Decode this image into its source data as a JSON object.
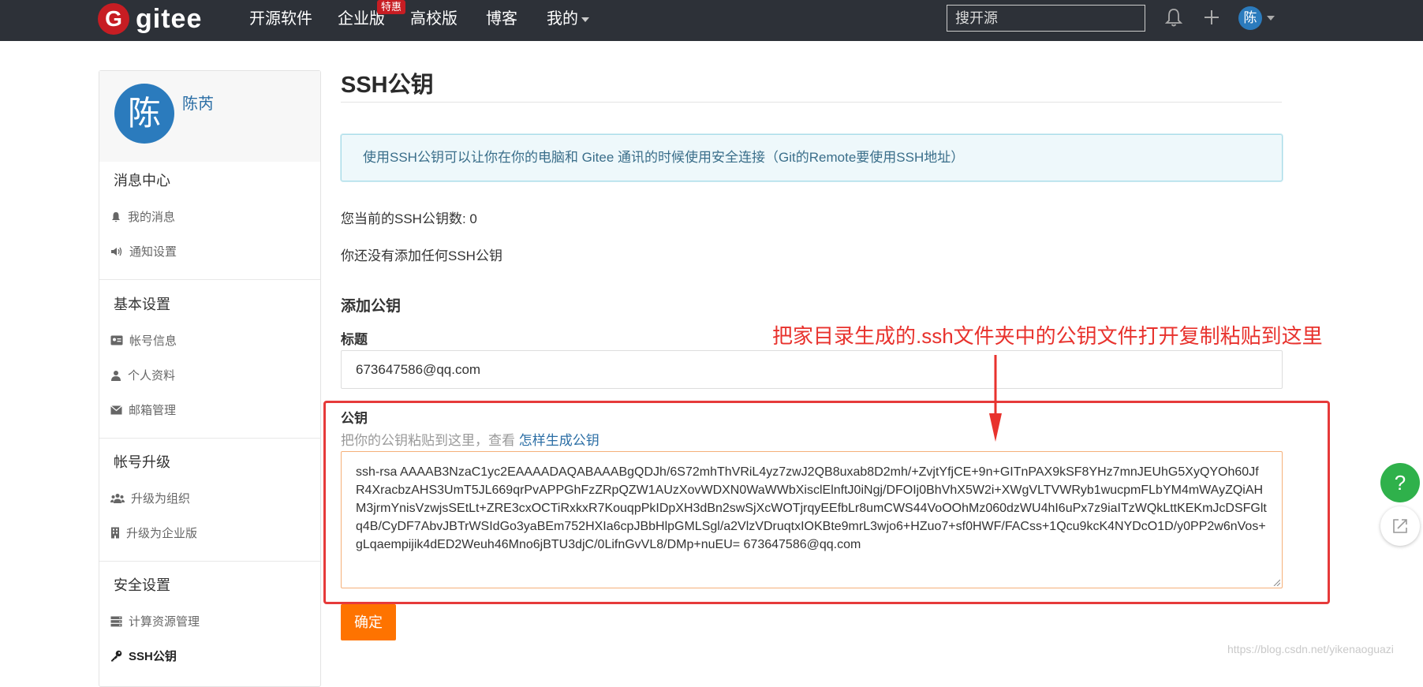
{
  "navbar": {
    "logo_letter": "G",
    "logo_text": "gitee",
    "items": [
      {
        "label": "开源软件"
      },
      {
        "label": "企业版"
      },
      {
        "label": "高校版"
      },
      {
        "label": "博客"
      },
      {
        "label": "我的"
      }
    ],
    "badge": "特惠",
    "search_placeholder": "搜开源",
    "avatar_letter": "陈"
  },
  "sidebar": {
    "avatar_letter": "陈",
    "user_name": "陈芮",
    "groups": [
      {
        "title": "消息中心",
        "items": [
          {
            "label": "我的消息",
            "icon": "bell-icon"
          },
          {
            "label": "通知设置",
            "icon": "speaker-icon"
          }
        ]
      },
      {
        "title": "基本设置",
        "items": [
          {
            "label": "帐号信息",
            "icon": "id-card-icon"
          },
          {
            "label": "个人资料",
            "icon": "user-icon"
          },
          {
            "label": "邮箱管理",
            "icon": "envelope-icon"
          }
        ]
      },
      {
        "title": "帐号升级",
        "items": [
          {
            "label": "升级为组织",
            "icon": "group-icon"
          },
          {
            "label": "升级为企业版",
            "icon": "building-icon"
          }
        ]
      },
      {
        "title": "安全设置",
        "items": [
          {
            "label": "计算资源管理",
            "icon": "server-icon"
          },
          {
            "label": "SSH公钥",
            "icon": "key-icon"
          }
        ]
      }
    ]
  },
  "main": {
    "title": "SSH公钥",
    "info": "使用SSH公钥可以让你在你的电脑和 Gitee 通讯的时候使用安全连接（Git的Remote要使用SSH地址）",
    "count_text": "您当前的SSH公钥数: 0",
    "empty_text": "你还没有添加任何SSH公钥",
    "add_heading": "添加公钥",
    "title_label": "标题",
    "title_value": "673647586@qq.com",
    "key_label": "公钥",
    "key_hint": "把你的公钥粘贴到这里，查看",
    "key_hint_link": "怎样生成公钥",
    "key_value": "ssh-rsa AAAAB3NzaC1yc2EAAAADAQABAAABgQDJh/6S72mhThVRiL4yz7zwJ2QB8uxab8D2mh/+ZvjtYfjCE+9n+GITnPAX9kSF8YHz7mnJEUhG5XyQYOh60JfR4XracbzAHS3UmT5JL669qrPvAPPGhFzZRpQZW1AUzXovWDXN0WaWWbXisclElnftJ0iNgj/DFOIj0BhVhX5W2i+XWgVLTVWRyb1wucpmFLbYM4mWAyZQiAHM3jrmYnisVzwjsSEtLt+ZRE3cxOCTiRxkxR7KouqpPkIDpXH3dBn2swSjXcWOTjrqyEEfbLr8umCWS44VoOOhMz060dzWU4hI6uPx7z9iaITzWQkLttKEKmJcDSFGltq4B/CyDF7AbvJBTrWSIdGo3yaBEm752HXIa6cpJBbHlpGMLSgl/a2VlzVDruqtxIOKBte9mrL3wjo6+HZuo7+sf0HWF/FACss+1Qcu9kcK4NYDcO1D/y0PP2w6nVos+gLqaempijik4dED2Weuh46Mno6jBTU3djC/0LifnGvVL8/DMp+nuEU= 673647586@qq.com",
    "confirm_label": "确定"
  },
  "annotation": {
    "text": "把家目录生成的.ssh文件夹中的公钥文件打开复制粘贴到这里",
    "color": "#e8322d"
  },
  "float_buttons": {
    "help": "?"
  },
  "watermark": "https://blog.csdn.net/yikenaoguazi",
  "colors": {
    "brand": "#c71d23",
    "navbar": "#2d3138",
    "confirm": "#fe7300",
    "link": "#2b6ea5"
  }
}
